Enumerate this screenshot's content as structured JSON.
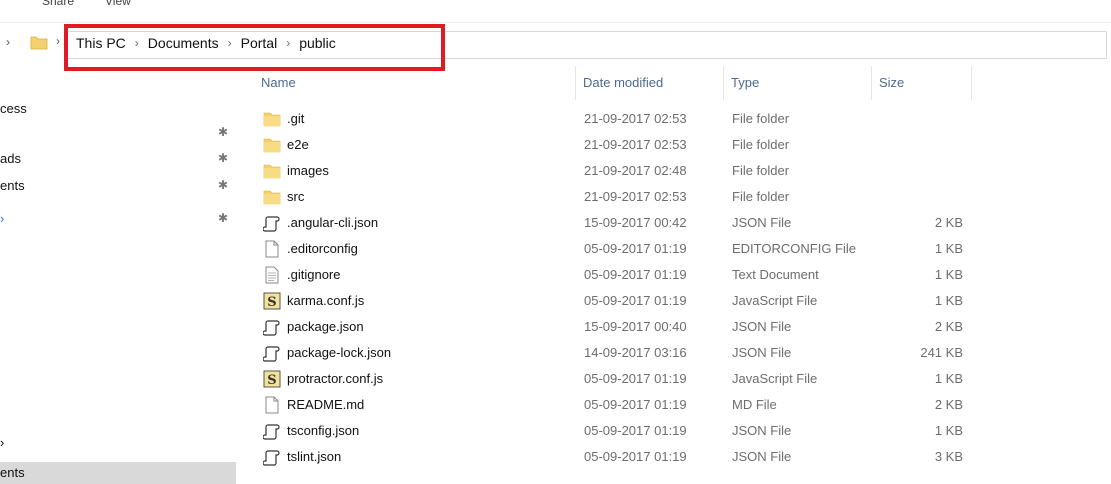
{
  "ribbon": {
    "share_label": "Share",
    "view_label": "View"
  },
  "address": {
    "crumbs": [
      "This PC",
      "Documents",
      "Portal",
      "public"
    ]
  },
  "nav": {
    "items": [
      {
        "label": "cess",
        "pinned": false
      },
      {
        "label": "",
        "pinned": true
      },
      {
        "label": "ads",
        "pinned": true
      },
      {
        "label": "ents",
        "pinned": true
      },
      {
        "label": "",
        "pinned": true
      },
      {
        "label": "",
        "pinned": false
      },
      {
        "label": "ents",
        "pinned": false
      }
    ],
    "pin_glyph": "📌"
  },
  "columns": {
    "name": "Name",
    "date": "Date modified",
    "type": "Type",
    "size": "Size"
  },
  "files": [
    {
      "icon": "folder",
      "name": ".git",
      "date": "21-09-2017 02:53",
      "type": "File folder",
      "size": ""
    },
    {
      "icon": "folder",
      "name": "e2e",
      "date": "21-09-2017 02:53",
      "type": "File folder",
      "size": ""
    },
    {
      "icon": "folder",
      "name": "images",
      "date": "21-09-2017 02:48",
      "type": "File folder",
      "size": ""
    },
    {
      "icon": "folder",
      "name": "src",
      "date": "21-09-2017 02:53",
      "type": "File folder",
      "size": ""
    },
    {
      "icon": "json",
      "name": ".angular-cli.json",
      "date": "15-09-2017 00:42",
      "type": "JSON File",
      "size": "2 KB"
    },
    {
      "icon": "blank",
      "name": ".editorconfig",
      "date": "05-09-2017 01:19",
      "type": "EDITORCONFIG File",
      "size": "1 KB"
    },
    {
      "icon": "text",
      "name": ".gitignore",
      "date": "05-09-2017 01:19",
      "type": "Text Document",
      "size": "1 KB"
    },
    {
      "icon": "js",
      "name": "karma.conf.js",
      "date": "05-09-2017 01:19",
      "type": "JavaScript File",
      "size": "1 KB"
    },
    {
      "icon": "json",
      "name": "package.json",
      "date": "15-09-2017 00:40",
      "type": "JSON File",
      "size": "2 KB"
    },
    {
      "icon": "json",
      "name": "package-lock.json",
      "date": "14-09-2017 03:16",
      "type": "JSON File",
      "size": "241 KB"
    },
    {
      "icon": "js",
      "name": "protractor.conf.js",
      "date": "05-09-2017 01:19",
      "type": "JavaScript File",
      "size": "1 KB"
    },
    {
      "icon": "blank",
      "name": "README.md",
      "date": "05-09-2017 01:19",
      "type": "MD File",
      "size": "2 KB"
    },
    {
      "icon": "json",
      "name": "tsconfig.json",
      "date": "05-09-2017 01:19",
      "type": "JSON File",
      "size": "1 KB"
    },
    {
      "icon": "json",
      "name": "tslint.json",
      "date": "05-09-2017 01:19",
      "type": "JSON File",
      "size": "3 KB"
    }
  ],
  "colors": {
    "highlight": "#e01b24",
    "folder": "#f4d06f",
    "header_text": "#4d6a8b",
    "selected": "#d9d9d9"
  }
}
